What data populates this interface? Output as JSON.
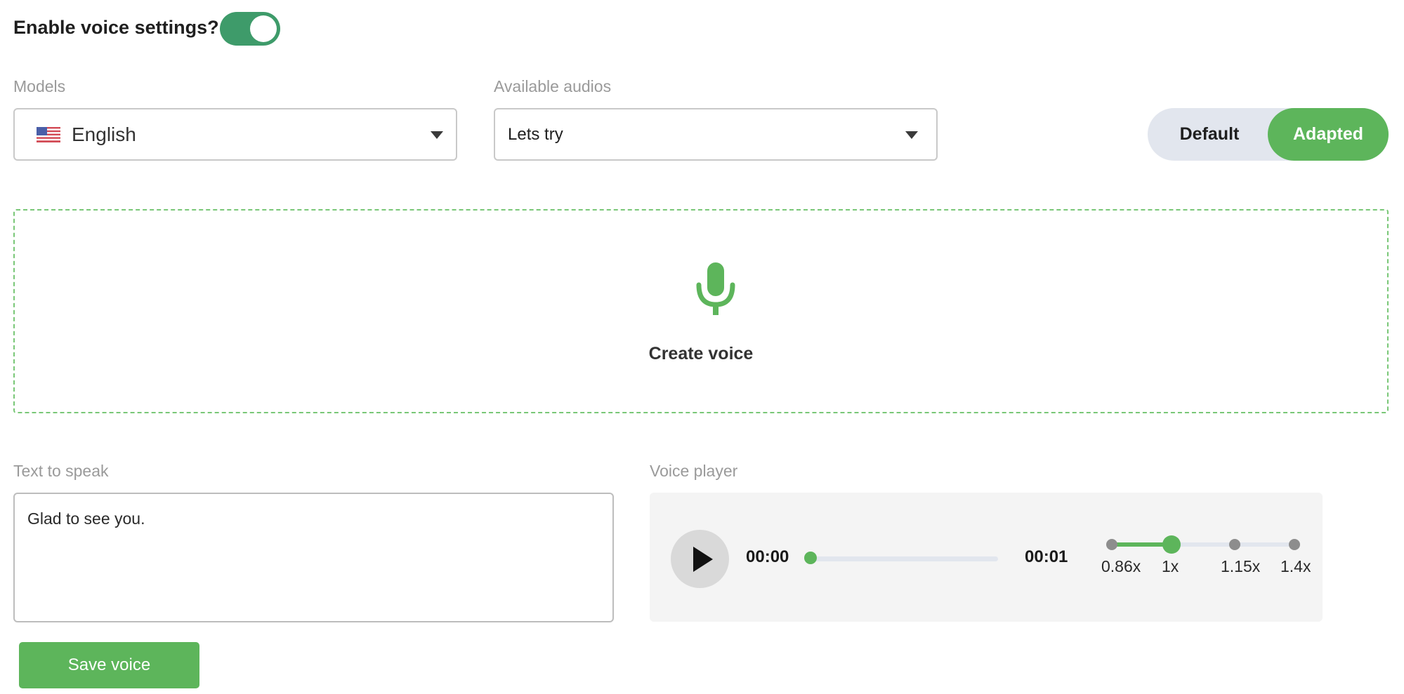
{
  "voice_settings": {
    "label": "Enable voice settings?",
    "enabled": true
  },
  "models": {
    "label": "Models",
    "selected": "English",
    "flag_icon": "us-flag-icon"
  },
  "audios": {
    "label": "Available audios",
    "selected": "Lets try"
  },
  "mode": {
    "options": [
      "Default",
      "Adapted"
    ],
    "selected": "Adapted"
  },
  "create_voice": {
    "label": "Create voice",
    "icon": "microphone-icon"
  },
  "text_to_speak": {
    "label": "Text to speak",
    "value": "Glad to see you."
  },
  "player": {
    "label": "Voice player",
    "current_time": "00:00",
    "duration": "00:01",
    "progress": 0,
    "speeds": [
      "0.86x",
      "1x",
      "1.15x",
      "1.4x"
    ],
    "selected_speed": "1x"
  },
  "save_button": "Save voice",
  "colors": {
    "accent": "#5db55b",
    "toggle": "#3e9b6a",
    "segment_bg": "#e2e6ee"
  }
}
